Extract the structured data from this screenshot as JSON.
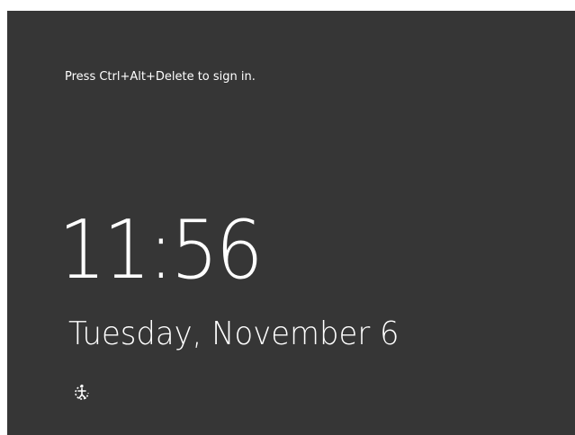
{
  "lock_screen": {
    "prompt": "Press Ctrl+Alt+Delete to sign in.",
    "time": "11:56",
    "date": "Tuesday, November 6",
    "ease_of_access_icon": "ease-of-access-icon"
  },
  "colors": {
    "background": "#363636",
    "text": "#ffffff"
  }
}
